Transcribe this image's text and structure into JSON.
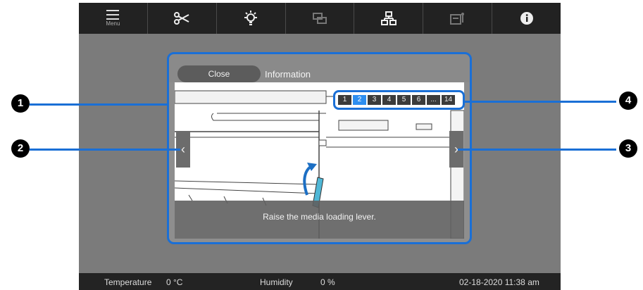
{
  "toolbar": {
    "items": [
      {
        "icon": "menu-icon",
        "label": "Menu"
      },
      {
        "icon": "scissors-icon",
        "label": ""
      },
      {
        "icon": "light-icon",
        "label": ""
      },
      {
        "icon": "windows-icon",
        "label": ""
      },
      {
        "icon": "network-icon",
        "label": ""
      },
      {
        "icon": "maintenance-icon",
        "label": ""
      },
      {
        "icon": "info-icon",
        "label": ""
      }
    ]
  },
  "panel": {
    "close_label": "Close",
    "title": "Information",
    "caption": "Raise the media loading lever.",
    "pages": [
      "1",
      "2",
      "3",
      "4",
      "5",
      "6",
      "...",
      "14"
    ],
    "current_page": "2"
  },
  "callouts": [
    "1",
    "2",
    "3",
    "4"
  ],
  "status": {
    "temperature_label": "Temperature",
    "temperature_value": "0 °C",
    "humidity_label": "Humidity",
    "humidity_value": "0 %",
    "datetime": "02-18-2020 11:38 am"
  },
  "colors": {
    "highlight": "#1a6fd6",
    "active_page": "#2d8ef0",
    "toolbar_bg": "#222222"
  }
}
